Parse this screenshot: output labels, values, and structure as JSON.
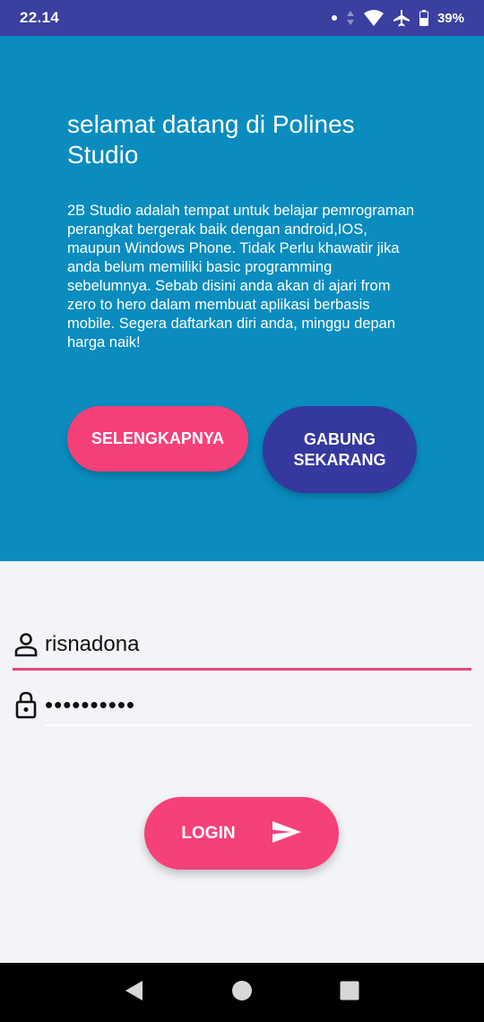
{
  "status_bar": {
    "time": "22.14",
    "battery": "39%",
    "icons": [
      "notification-dot-icon",
      "signal-arrows-icon",
      "wifi-icon",
      "airplane-icon",
      "battery-icon"
    ]
  },
  "hero": {
    "title": "selamat datang di Polines Studio",
    "description": "2B Studio adalah tempat untuk belajar pemrograman perangkat bergerak baik dengan android,IOS, maupun Windows Phone. Tidak Perlu khawatir jika anda belum memiliki basic programming sebelumnya. Sebab disini anda akan di ajari from zero to hero dalam membuat aplikasi berbasis mobile. Segera daftarkan diri anda, minggu depan harga naik!",
    "more_button": "SELENGKAPNYA",
    "join_button": "GABUNG SEKARANG"
  },
  "login_form": {
    "username": "risnadona",
    "password_masked": "••••••••••",
    "login_button": "LOGIN"
  },
  "nav_bar": {
    "icons": [
      "back-icon",
      "home-icon",
      "recents-icon"
    ]
  },
  "colors": {
    "status_bar": "#3a3fa0",
    "hero_bg": "#0a8cbf",
    "accent_pink": "#f5407a",
    "accent_indigo": "#35389e",
    "page_bg": "#f2f4f7"
  }
}
